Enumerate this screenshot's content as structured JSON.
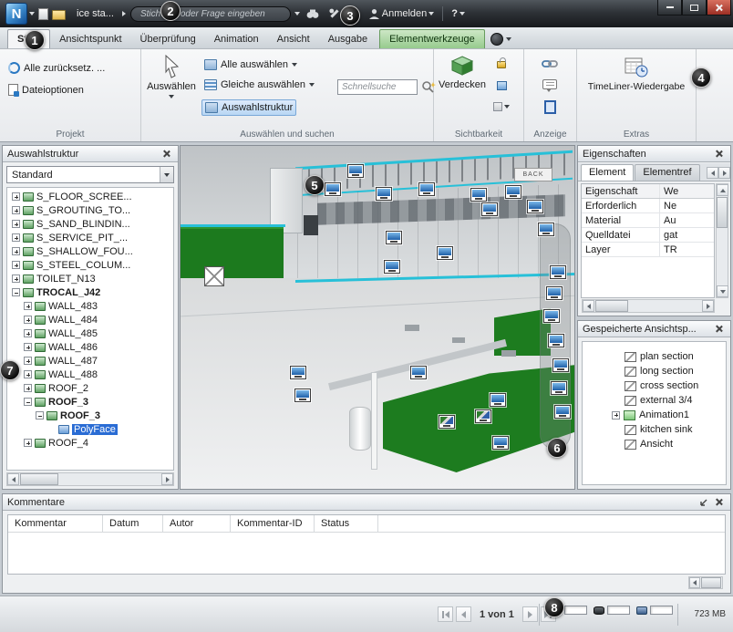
{
  "titlebar": {
    "app_button": "N",
    "title": "ice sta...",
    "search_placeholder": "Stichwort oder Frage eingeben",
    "signin_label": "Anmelden",
    "help_label": "?"
  },
  "ribbon": {
    "tabs": [
      {
        "label": "Start"
      },
      {
        "label": "Ansichtspunkt"
      },
      {
        "label": "Überprüfung"
      },
      {
        "label": "Animation"
      },
      {
        "label": "Ansicht"
      },
      {
        "label": "Ausgabe"
      },
      {
        "label": "Elementwerkzeuge"
      }
    ],
    "projekt": {
      "label": "Projekt",
      "reset_all": "Alle zurücksetz. ...",
      "file_options": "Dateioptionen"
    },
    "select_group": {
      "label": "Auswählen und suchen",
      "select": "Auswählen",
      "select_all": "Alle auswählen",
      "select_same": "Gleiche auswählen",
      "quick_find_placeholder": "Schnellsuche",
      "selection_tree": "Auswahlstruktur"
    },
    "visibility": {
      "label": "Sichtbarkeit",
      "hide": "Verdecken"
    },
    "display": {
      "label": "Anzeige"
    },
    "extras": {
      "label": "Extras",
      "timeliner": "TimeLiner-Wiedergabe"
    }
  },
  "selection_tree": {
    "title": "Auswahlstruktur",
    "mode": "Standard",
    "items": [
      {
        "label": "S_FLOOR_SCREE..."
      },
      {
        "label": "S_GROUTING_TO..."
      },
      {
        "label": "S_SAND_BLINDIN..."
      },
      {
        "label": "S_SERVICE_PIT_..."
      },
      {
        "label": "S_SHALLOW_FOU..."
      },
      {
        "label": "S_STEEL_COLUM..."
      },
      {
        "label": "TOILET_N13"
      },
      {
        "label": "TROCAL_J42"
      },
      {
        "label": "WALL_483"
      },
      {
        "label": "WALL_484"
      },
      {
        "label": "WALL_485"
      },
      {
        "label": "WALL_486"
      },
      {
        "label": "WALL_487"
      },
      {
        "label": "WALL_488"
      },
      {
        "label": "ROOF_2"
      },
      {
        "label": "ROOF_3"
      },
      {
        "label": "ROOF_3"
      },
      {
        "label": "PolyFace"
      },
      {
        "label": "ROOF_4"
      }
    ]
  },
  "properties": {
    "title": "Eigenschaften",
    "tabs": [
      "Element",
      "Elementref"
    ],
    "header": [
      "Eigenschaft",
      "We"
    ],
    "rows": [
      [
        "Erforderlich",
        "Ne"
      ],
      [
        "Material",
        "Au"
      ],
      [
        "Quelldatei",
        "gat"
      ],
      [
        "Layer",
        "TR"
      ]
    ]
  },
  "viewpoints": {
    "title": "Gespeicherte Ansichtsp...",
    "items": [
      "plan section",
      "long section",
      "cross section",
      "external 3/4",
      "Animation1",
      "kitchen sink",
      "Ansicht"
    ]
  },
  "comments": {
    "title": "Kommentare",
    "columns": [
      "Kommentar",
      "Datum",
      "Autor",
      "Kommentar-ID",
      "Status"
    ]
  },
  "statusbar": {
    "page_indicator": "1 von 1",
    "memory": "723 MB"
  },
  "viewport": {
    "back_label": "BACK"
  },
  "callouts": [
    "1",
    "2",
    "3",
    "4",
    "5",
    "6",
    "7",
    "8"
  ]
}
